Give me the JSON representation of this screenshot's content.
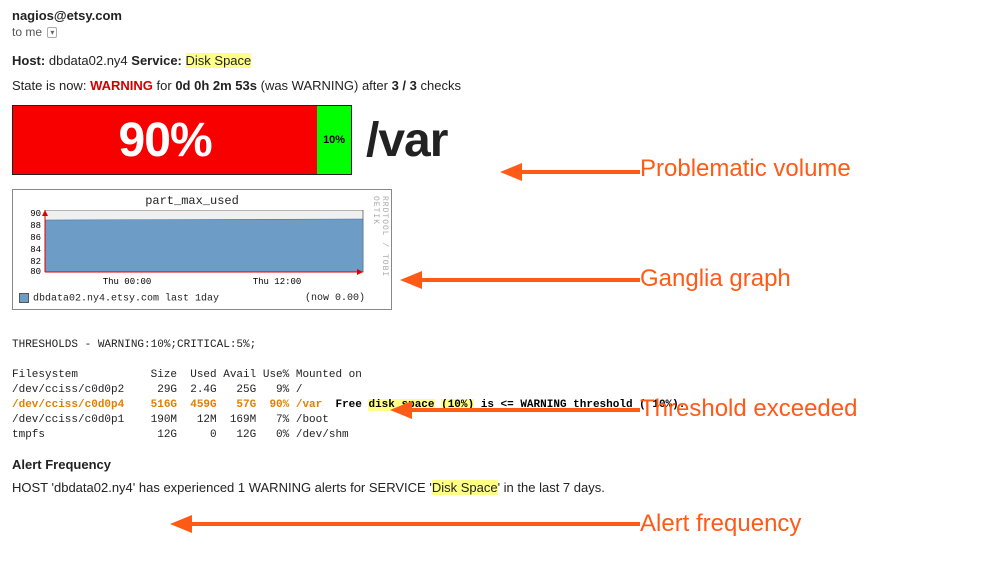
{
  "from": "nagios@etsy.com",
  "to_line": "to me",
  "hostline": {
    "host_label": "Host",
    "host": "dbdata02.ny4",
    "service_label": "Service",
    "service": "Disk Space"
  },
  "stateline": {
    "prefix": "State is now:",
    "state": "WARNING",
    "for_label": "for",
    "duration": "0d 0h 2m 53s",
    "was": "(was WARNING) after",
    "checks": "3 / 3",
    "checks_suffix": "checks"
  },
  "bar": {
    "red_pct": 90,
    "red_label": "90%",
    "green_label": "10%",
    "volume": "/var"
  },
  "annotations": {
    "a1": "Problematic volume",
    "a2": "Ganglia graph",
    "a3": "Threshold exceeded",
    "a4": "Alert frequency"
  },
  "graph": {
    "title": "part_max_used",
    "side": "RRDTOOL / TOBI OETIK",
    "legend_host": "dbdata02.ny4.etsy.com last 1day",
    "legend_now": "(now 0.00)",
    "y_ticks": [
      "90",
      "88",
      "86",
      "84",
      "82",
      "80"
    ],
    "x_ticks": [
      "Thu 00:00",
      "Thu 12:00"
    ]
  },
  "thresholds_header": "THRESHOLDS - WARNING:10%;CRITICAL:5%;",
  "fs_header": "Filesystem           Size  Used Avail Use% Mounted on",
  "fs_rows": {
    "r0": "/dev/cciss/c0d0p2     29G  2.4G   25G   9% /",
    "r1_warn": "/dev/cciss/c0d0p4    516G  459G   57G  90% /var",
    "r1_msg_a": "  Free ",
    "r1_msg_disk": "disk space",
    "r1_msg_b": " ",
    "r1_msg_pct": "(10%)",
    "r1_msg_c": " is <= WARNING threshold ( 10%).",
    "r2": "/dev/cciss/c0d0p1    190M   12M  169M   7% /boot",
    "r3": "tmpfs                 12G     0   12G   0% /dev/shm"
  },
  "alert_freq": {
    "title": "Alert Frequency",
    "body_prefix": "HOST '",
    "host": "dbdata02.ny4",
    "body_mid": "' has experienced 1 WARNING alerts for SERVICE '",
    "service": "Disk Space",
    "body_suffix": "' in the last 7 days."
  },
  "chart_data": {
    "type": "area",
    "title": "part_max_used",
    "xlabel": "",
    "ylabel": "",
    "ylim": [
      80,
      90
    ],
    "x_ticks": [
      "Thu 00:00",
      "Thu 12:00"
    ],
    "series": [
      {
        "name": "dbdata02.ny4.etsy.com last 1day",
        "approx_value": 88.5,
        "now": 0.0
      }
    ],
    "note": "Area chart nearly flat around 88–89 across the full day window."
  }
}
